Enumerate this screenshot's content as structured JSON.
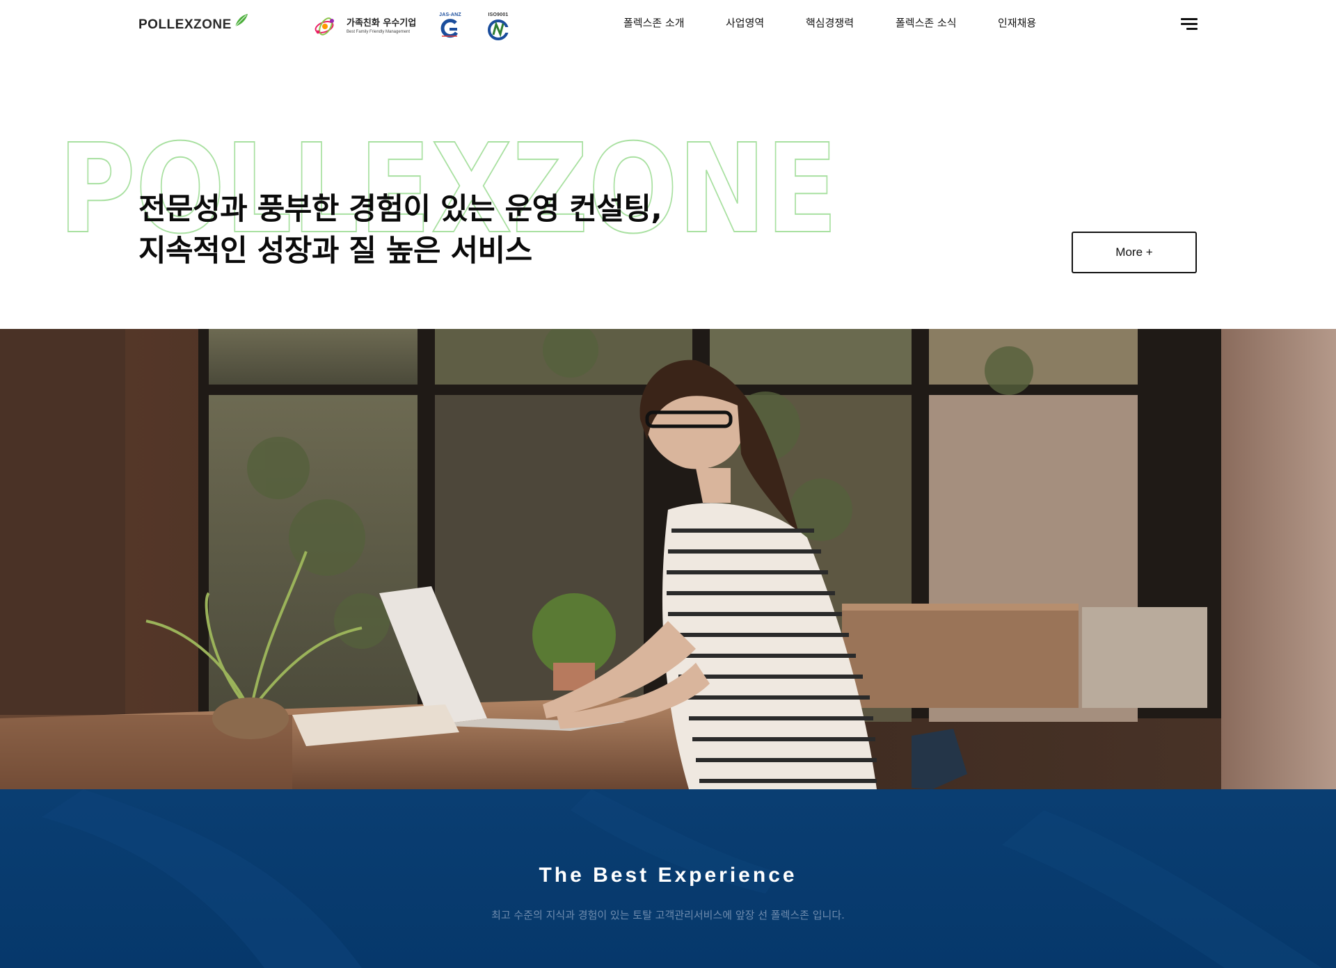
{
  "header": {
    "logo": {
      "part1": "POLLEX",
      "part2": "ZONE"
    },
    "certifications": {
      "family_friendly": {
        "main": "가족친화 우수기업",
        "sub": "Best Family Friendly Management"
      },
      "jas_anz": {
        "caption": "JAS-ANZ"
      },
      "iso": {
        "caption": "ISO9001"
      }
    },
    "nav": [
      {
        "label": "폴렉스존 소개"
      },
      {
        "label": "사업영역"
      },
      {
        "label": "핵심경쟁력"
      },
      {
        "label": "폴렉스존 소식"
      },
      {
        "label": "인재채용"
      }
    ],
    "menu_icon": "hamburger-icon"
  },
  "hero": {
    "outline_text": "POLLEXZONE",
    "headline_line1": "전문성과 풍부한 경험이 있는 운영 컨설팅,",
    "headline_line2": "지속적인 성장과 질 높은 서비스",
    "more_button": "More +"
  },
  "band": {
    "title": "The Best Experience",
    "subtitle": "최고 수준의 지식과 경험이 있는 토탈 고객관리서비스에 앞장 선 폴렉스존 입니다."
  },
  "colors": {
    "outline_green": "#a8e0a0",
    "band_blue": "#0a3e72",
    "band_sub": "#6f8cae",
    "leaf_green": "#4caf3c"
  }
}
